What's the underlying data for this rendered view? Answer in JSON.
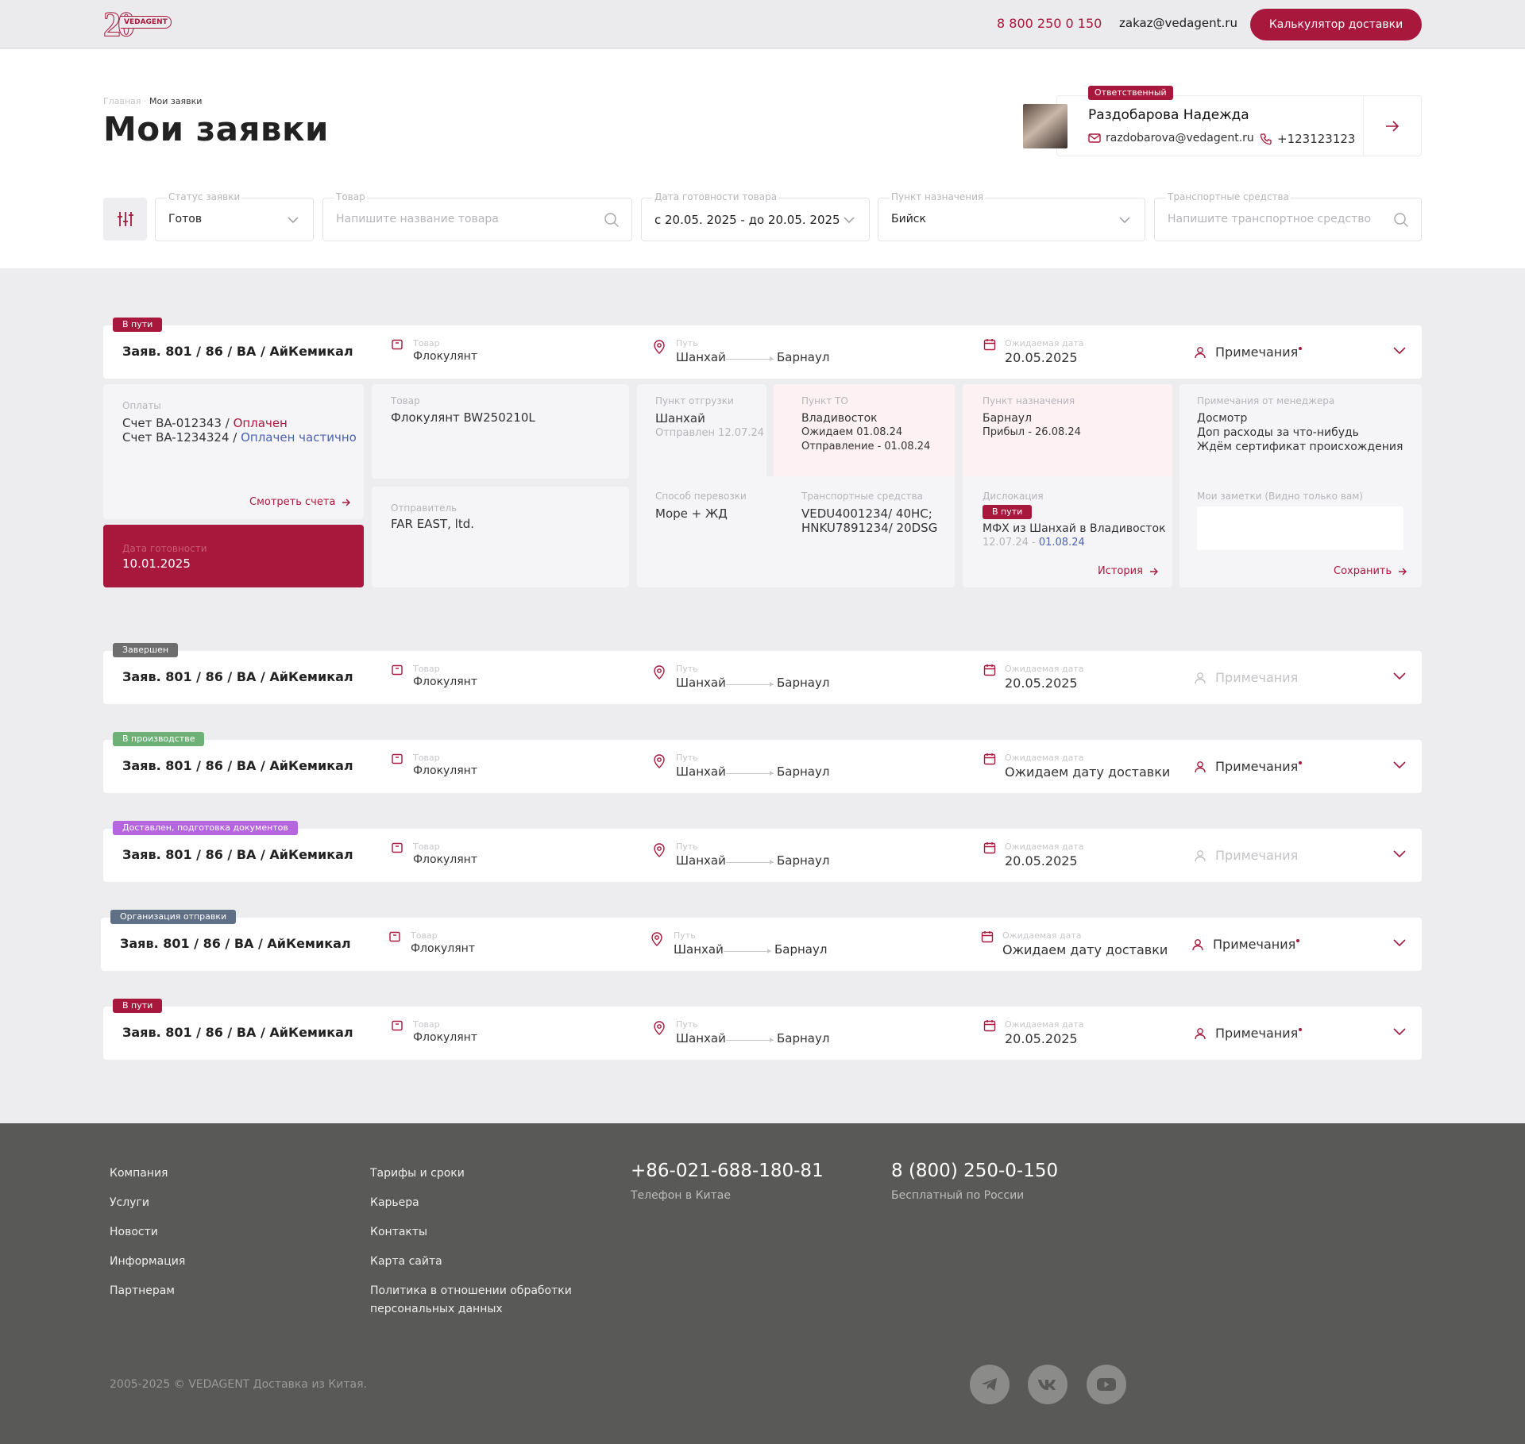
{
  "header": {
    "phone": "8 800 250 0 150",
    "email": "zakaz@vedagent.ru",
    "calc_button": "Калькулятор доставки",
    "logo_text": "VEDAGENT",
    "logo_num": "20"
  },
  "breadcrumb": {
    "home": "Главная",
    "sep": "·",
    "current": "Мои заявки"
  },
  "page_title": "Мои заявки",
  "manager": {
    "tag": "Ответственный",
    "name": "Раздобарова Надежда",
    "email": "razdobarova@vedagent.ru",
    "phone": "+123123123"
  },
  "filters": {
    "status": {
      "label": "Статус заявки",
      "value": "Готов"
    },
    "product": {
      "label": "Товар",
      "placeholder": "Напишите название товара"
    },
    "date": {
      "label": "Дата готовности товара",
      "value": "с 20.05. 2025 - до 20.05. 2025"
    },
    "destination": {
      "label": "Пункт назначения",
      "value": "Бийск"
    },
    "transport": {
      "label": "Транспортные средства",
      "placeholder": "Напишите транспортное средство"
    }
  },
  "labels": {
    "product": "Товар",
    "path": "Путь",
    "expected": "Ожидаемая дата",
    "notes": "Примечания"
  },
  "orders": [
    {
      "badge": "В пути",
      "badge_color": "#a8183c",
      "id": "Заяв. 801 / 86 / BA / АйКемикал",
      "product": "Флокулянт",
      "from": "Шанхай",
      "to": "Барнаул",
      "date": "20.05.2025",
      "notes_active": true
    },
    {
      "badge": "Завершен",
      "badge_color": "#6e6e6e",
      "id": "Заяв. 801 / 86 / BA / АйКемикал",
      "product": "Флокулянт",
      "from": "Шанхай",
      "to": "Барнаул",
      "date": "20.05.2025",
      "notes_active": false
    },
    {
      "badge": "В производстве",
      "badge_color": "#6db176",
      "id": "Заяв. 801 / 86 / BA / АйКемикал",
      "product": "Флокулянт",
      "from": "Шанхай",
      "to": "Барнаул",
      "date": "Ожидаем дату доставки",
      "notes_active": true
    },
    {
      "badge": "Доставлен, подготовка документов",
      "badge_color": "#b565e0",
      "id": "Заяв. 801 / 86 / BA / АйКемикал",
      "product": "Флокулянт",
      "from": "Шанхай",
      "to": "Барнаул",
      "date": "20.05.2025",
      "notes_active": false
    },
    {
      "badge": "Организация отправки",
      "badge_color": "#5f6f86",
      "id": "Заяв. 801 / 86 / BA / АйКемикал",
      "product": "Флокулянт",
      "from": "Шанхай",
      "to": "Барнаул",
      "date": "Ожидаем дату доставки",
      "notes_active": true
    },
    {
      "badge": "В пути",
      "badge_color": "#a8183c",
      "id": "Заяв. 801 / 86 / BA / АйКемикал",
      "product": "Флокулянт",
      "from": "Шанхай",
      "to": "Барнаул",
      "date": "20.05.2025",
      "notes_active": true
    }
  ],
  "details": {
    "payments": {
      "label": "Оплаты",
      "inv1": "Счет BA-012343",
      "inv1_status": "Оплачен",
      "inv2": "Счет BA-1234324",
      "inv2_status": "Оплачен частично",
      "link": "Смотреть счета"
    },
    "ready": {
      "label": "Дата готовности",
      "date": "10.01.2025"
    },
    "product": {
      "label": "Товар",
      "value": "Флокулянт BW250210L"
    },
    "sender": {
      "label": "Отправитель",
      "value": "FAR EAST, ltd."
    },
    "ship_point": {
      "label": "Пункт отгрузки",
      "city": "Шанхай",
      "sub": "Отправлен 12.07.24"
    },
    "customs": {
      "label": "Пункт ТО",
      "city": "Владивосток",
      "sub1": "Ожидаем 01.08.24",
      "sub2": "Отправление - 01.08.24"
    },
    "dest": {
      "label": "Пункт назначения",
      "city": "Барнаул",
      "sub": "Прибыл - 26.08.24"
    },
    "mgr_notes": {
      "label": "Примечания от менеджера",
      "l1": "Досмотр",
      "l2": "Доп расходы за что-нибудь",
      "l3": "Ждём сертификат происхождения"
    },
    "method": {
      "label": "Способ перевозки",
      "value": "Море + ЖД"
    },
    "vehicles": {
      "label": "Транспортные средства",
      "l1": "VEDU4001234/ 40HC;",
      "l2": "HNKU7891234/ 20DSG"
    },
    "dislocation": {
      "label": "Дислокация",
      "badge": "В пути",
      "text": "МФХ из Шанхай в Владивосток",
      "date1": "12.07.24",
      "sep": " - ",
      "date2": "01.08.24",
      "link": "История"
    },
    "my_notes": {
      "label": "Мои заметки (Видно только вам)",
      "link": "Сохранить"
    }
  },
  "footer": {
    "col1": [
      "Компания",
      "Услуги",
      "Новости",
      "Информация",
      "Партнерам"
    ],
    "col2": [
      "Тарифы и сроки",
      "Карьера",
      "Контакты",
      "Карта сайта",
      "Политика в отношении обработки",
      "персональных данных"
    ],
    "phone_cn": "+86-021-688-180-81",
    "phone_cn_label": "Телефон в Китае",
    "phone_ru": "8 (800) 250-0-150",
    "phone_ru_label": "Бесплатный по России",
    "copyright": "2005-2025 © VEDAGENT Доставка из Китая."
  }
}
